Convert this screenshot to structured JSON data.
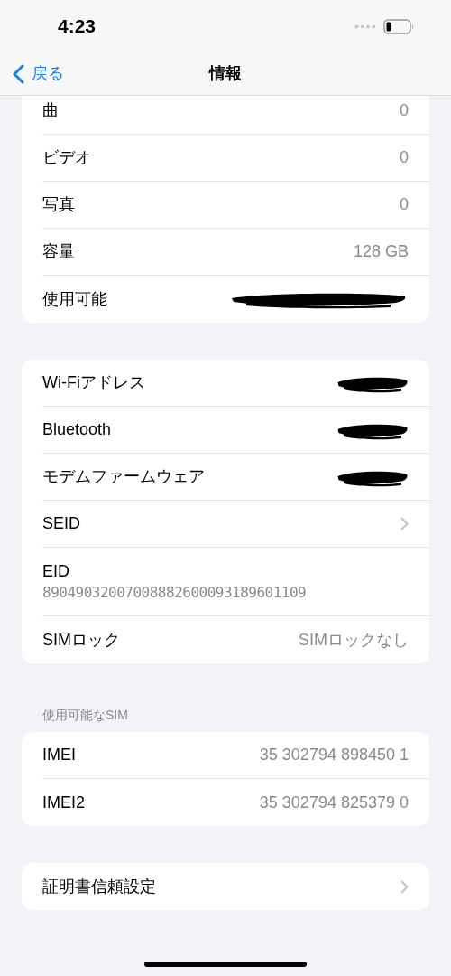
{
  "status_bar": {
    "time": "4:23"
  },
  "nav_bar": {
    "back": "戻る",
    "title": "情報"
  },
  "groups": [
    {
      "rows": [
        {
          "kind": "value",
          "label": "曲",
          "value": "0"
        },
        {
          "kind": "value",
          "label": "ビデオ",
          "value": "0"
        },
        {
          "kind": "value",
          "label": "写真",
          "value": "0"
        },
        {
          "kind": "value",
          "label": "容量",
          "value": "128 GB"
        },
        {
          "kind": "redacted",
          "label": "使用可能"
        }
      ]
    },
    {
      "rows": [
        {
          "kind": "redacted",
          "label": "Wi-Fiアドレス"
        },
        {
          "kind": "redacted",
          "label": "Bluetooth"
        },
        {
          "kind": "redacted",
          "label": "モデムファームウェア"
        },
        {
          "kind": "link",
          "label": "SEID"
        },
        {
          "kind": "stacked",
          "label": "EID",
          "value": "89049032007008882600093189601109"
        },
        {
          "kind": "value",
          "label": "SIMロック",
          "value": "SIMロックなし"
        }
      ]
    },
    {
      "header": "使用可能なSIM",
      "rows": [
        {
          "kind": "value",
          "label": "IMEI",
          "value": "35 302794 898450 1"
        },
        {
          "kind": "value",
          "label": "IMEI2",
          "value": "35 302794 825379 0"
        }
      ]
    },
    {
      "rows": [
        {
          "kind": "link",
          "label": "証明書信頼設定"
        }
      ]
    }
  ]
}
